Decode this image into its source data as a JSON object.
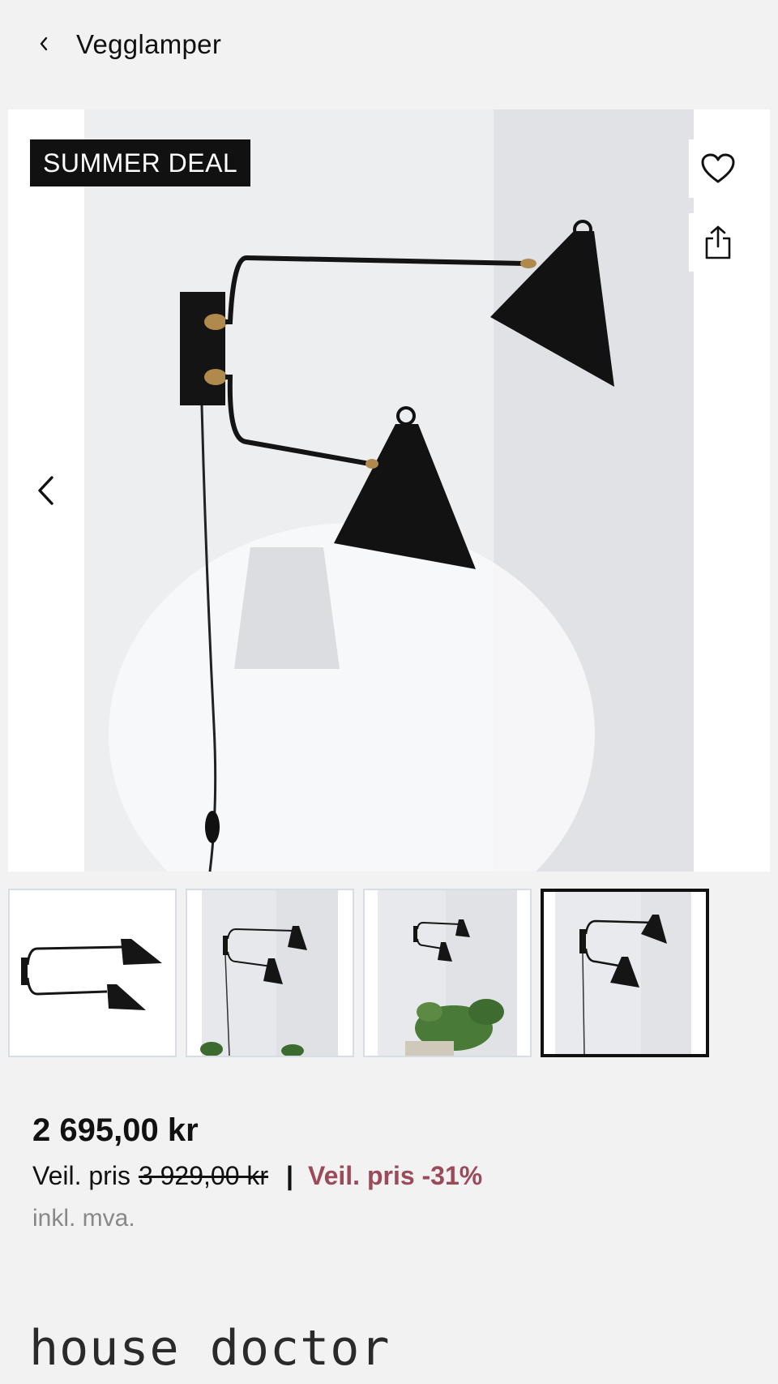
{
  "header": {
    "title": "Vegglamper"
  },
  "hero": {
    "badge": "SUMMER DEAL"
  },
  "icons": {
    "back": "chevron-left-icon",
    "favorite": "heart-icon",
    "share": "share-icon",
    "previous": "chevron-left-icon"
  },
  "thumbnails": [
    {
      "label": "thumbnail-1",
      "active": false
    },
    {
      "label": "thumbnail-2",
      "active": false
    },
    {
      "label": "thumbnail-3",
      "active": false
    },
    {
      "label": "thumbnail-4",
      "active": true
    }
  ],
  "pricing": {
    "price": "2 695,00 kr",
    "rec_label": "Veil. pris",
    "old_price": "3 929,00 kr",
    "separator": "|",
    "discount": "Veil. pris -31%",
    "vat": "inkl. mva."
  },
  "brand": {
    "name": "house doctor"
  },
  "colors": {
    "background": "#f2f2f2",
    "badge_bg": "#111111",
    "discount": "#9b4a5a",
    "active_thumb_border": "#111111"
  }
}
